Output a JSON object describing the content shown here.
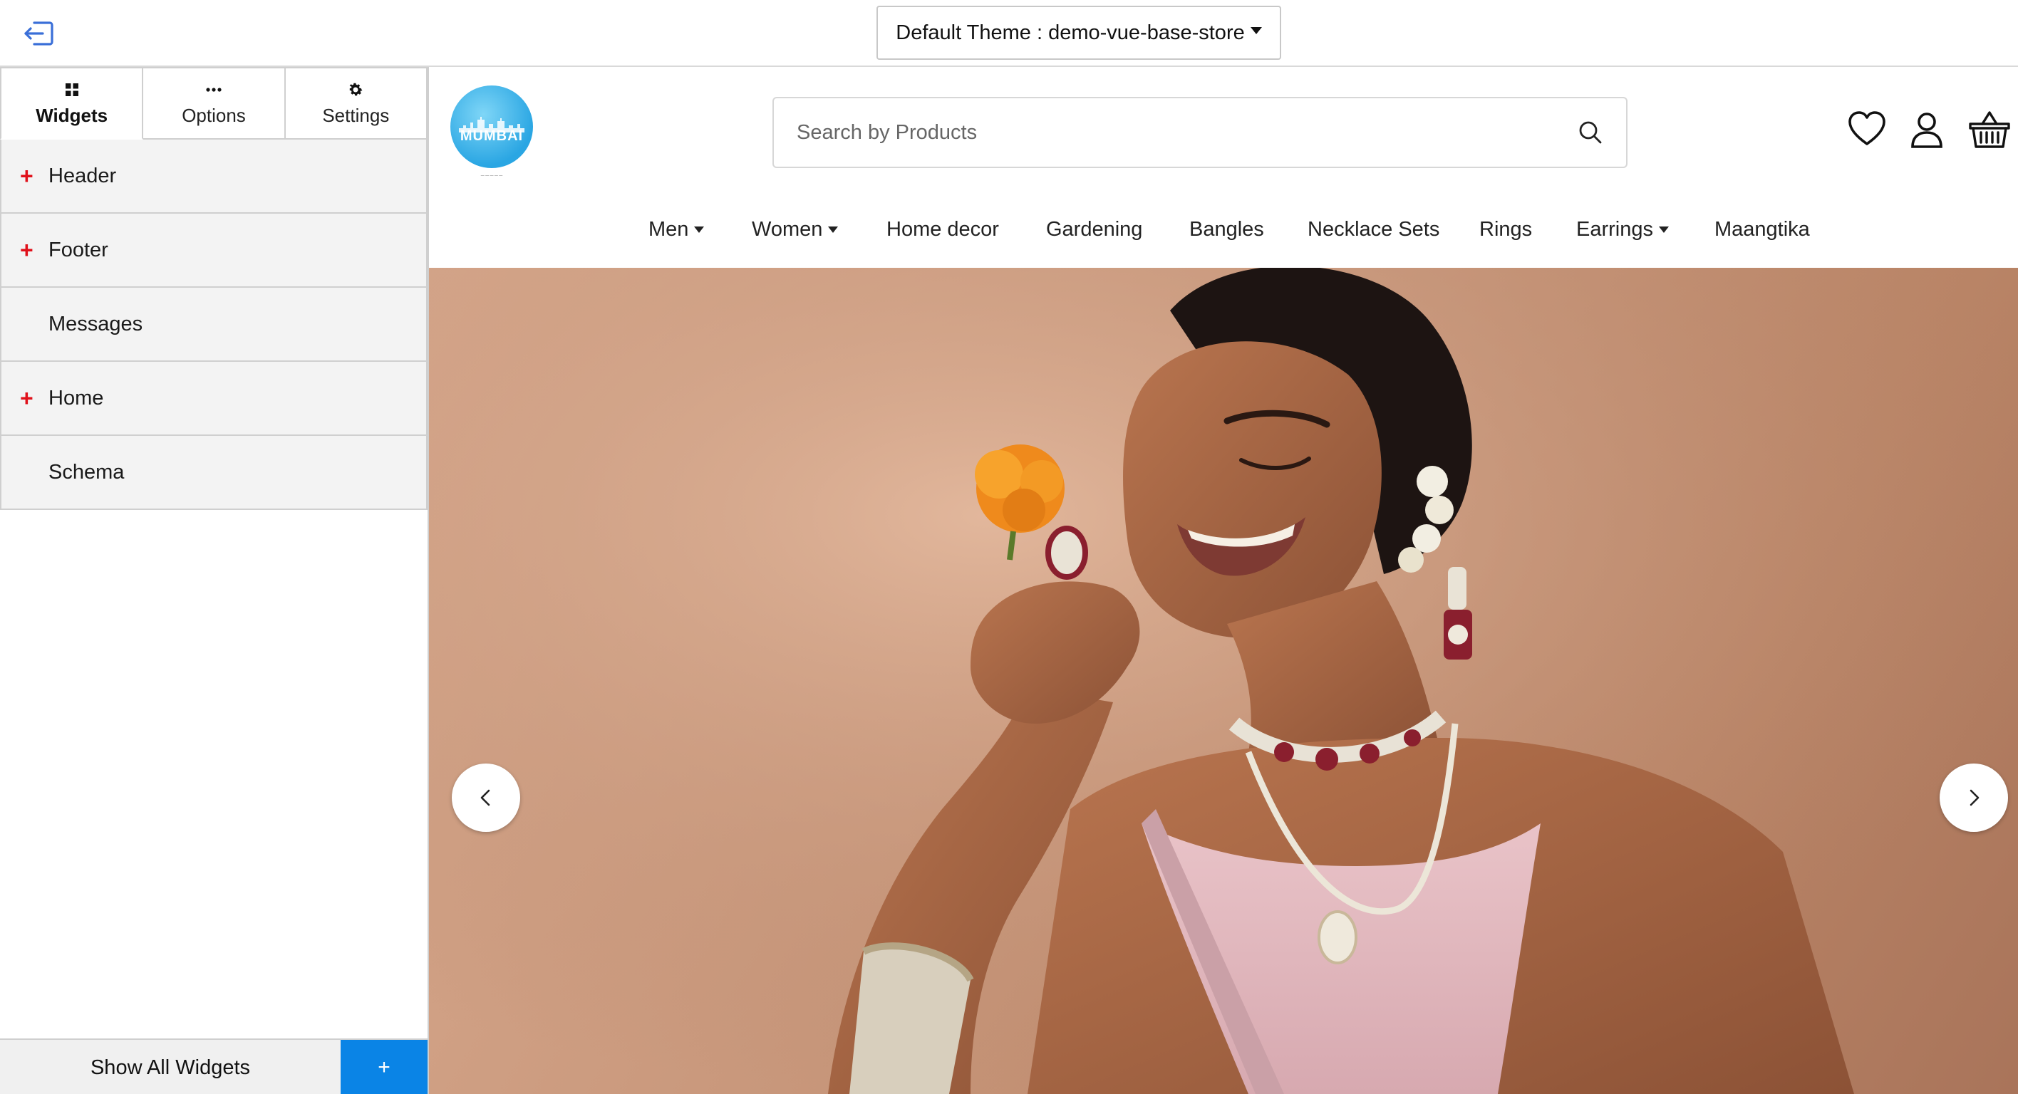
{
  "topbar": {
    "exit_icon": "logout-icon",
    "theme_label": "Default Theme : demo-vue-base-store"
  },
  "panel": {
    "tabs": [
      {
        "label": "Widgets",
        "icon": "grid-icon",
        "active": true
      },
      {
        "label": "Options",
        "icon": "dots-icon",
        "active": false
      },
      {
        "label": "Settings",
        "icon": "gear-icon",
        "active": false
      }
    ],
    "items": [
      {
        "label": "Header",
        "expandable": true
      },
      {
        "label": "Footer",
        "expandable": true
      },
      {
        "label": "Messages",
        "expandable": false
      },
      {
        "label": "Home",
        "expandable": true
      },
      {
        "label": "Schema",
        "expandable": false
      }
    ],
    "show_all_label": "Show All Widgets",
    "add_label": "+"
  },
  "store": {
    "logo_text": "MUMBAI",
    "search_placeholder": "Search by Products",
    "nav": [
      {
        "label": "Men",
        "dropdown": true
      },
      {
        "label": "Women",
        "dropdown": true
      },
      {
        "label": "Home decor",
        "dropdown": false
      },
      {
        "label": "Gardening",
        "dropdown": false
      },
      {
        "label": "Bangles",
        "dropdown": false
      },
      {
        "label": "Necklace Sets",
        "dropdown": false
      },
      {
        "label": "Rings",
        "dropdown": false
      },
      {
        "label": "Earrings",
        "dropdown": true
      },
      {
        "label": "Maangtika",
        "dropdown": false
      }
    ],
    "icons": [
      "heart-icon",
      "user-icon",
      "basket-icon"
    ]
  },
  "colors": {
    "accent": "#0a84e6",
    "plus_red": "#e0101a",
    "hero_bg": "#c8977b"
  }
}
